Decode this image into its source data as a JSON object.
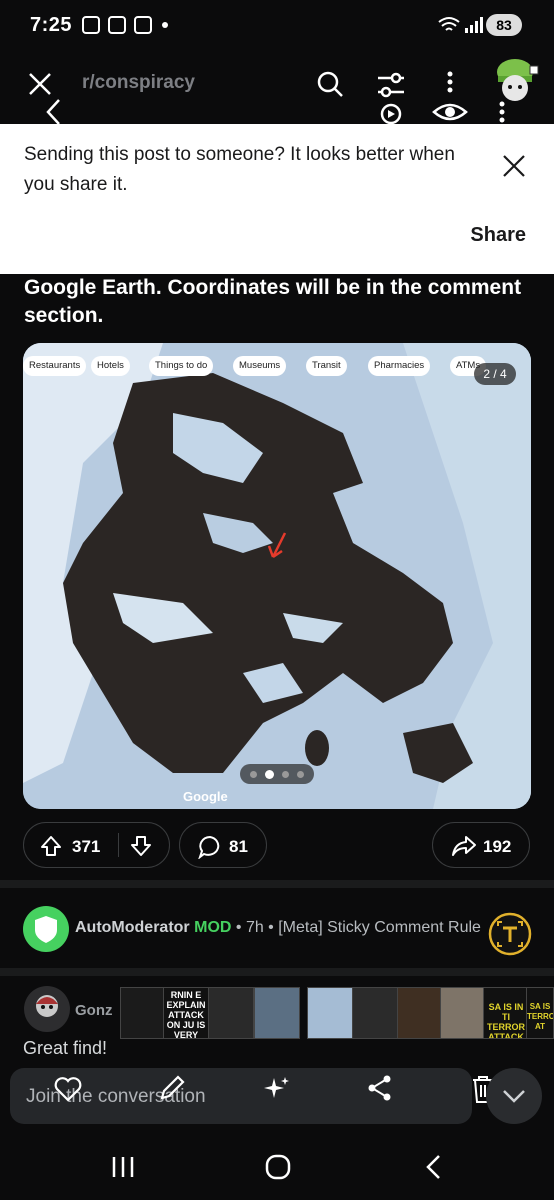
{
  "status_bar": {
    "time": "7:25",
    "battery": "83"
  },
  "header": {
    "subreddit": "r/conspiracy"
  },
  "share_banner": {
    "message": "Sending this post to someone? It looks better when you share it.",
    "share_label": "Share"
  },
  "post": {
    "title": "Google Earth. Coordinates will be in the comment section.",
    "image": {
      "counter": "2 / 4",
      "map_chips": [
        "Restaurants",
        "Hotels",
        "Things to do",
        "Museums",
        "Transit",
        "Pharmacies",
        "ATMs"
      ],
      "watermark": "Google",
      "current_page": 2,
      "total_pages": 4
    },
    "upvotes": "371",
    "comments": "81",
    "shares": "192"
  },
  "comments": {
    "first": {
      "author": "AutoModerator",
      "mod_badge": "MOD",
      "meta": "• 7h • [Meta] Sticky Comment Rule"
    },
    "second": {
      "author": "Gonz",
      "body": "Great find!"
    }
  },
  "overlay_thumbs": [
    {
      "label": "",
      "color": "#1b1b1b"
    },
    {
      "label": "RNIN E EXPLAIN ATTACK ON JU IS VERY WRO",
      "color": "#111111"
    },
    {
      "label": "",
      "color": "#2a2a2a"
    },
    {
      "label": "",
      "color": "#5b6f83"
    },
    {
      "label": "",
      "color": "#a5bcd4"
    },
    {
      "label": "",
      "color": "#2b2b2b"
    },
    {
      "label": "",
      "color": "#3f2f22"
    },
    {
      "label": "",
      "color": "#7e7468"
    },
    {
      "label": "SA IS IN TI TERROR ATTACK ON",
      "color": "#111111"
    },
    {
      "label": "SA IS TERROR AT",
      "color": "#111111"
    }
  ],
  "composer": {
    "placeholder": "Join the conversation"
  },
  "colors": {
    "mod_green": "#46d160",
    "automod_avatar": "#46d160",
    "banner_bg": "#ffffff",
    "upvote_red": "#ff4500"
  }
}
